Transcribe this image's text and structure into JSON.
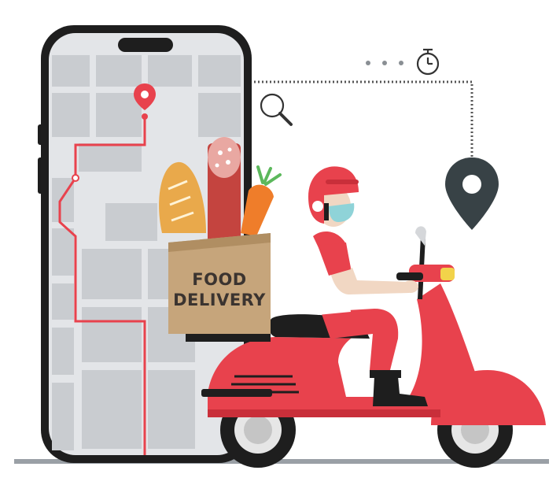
{
  "bag": {
    "line1": "FOOD",
    "line2": "DELIVERY"
  },
  "colors": {
    "brand_red": "#e8424d",
    "dark_red": "#c92f3a",
    "pin_dark": "#384246",
    "map_bg": "#e3e5e8",
    "map_block": "#c9ccd0",
    "bag_kraft": "#c6a57b",
    "ground": "#9aa0a6"
  },
  "icons": [
    "map-pin-icon",
    "location-pin-icon",
    "search-icon",
    "stopwatch-icon"
  ]
}
